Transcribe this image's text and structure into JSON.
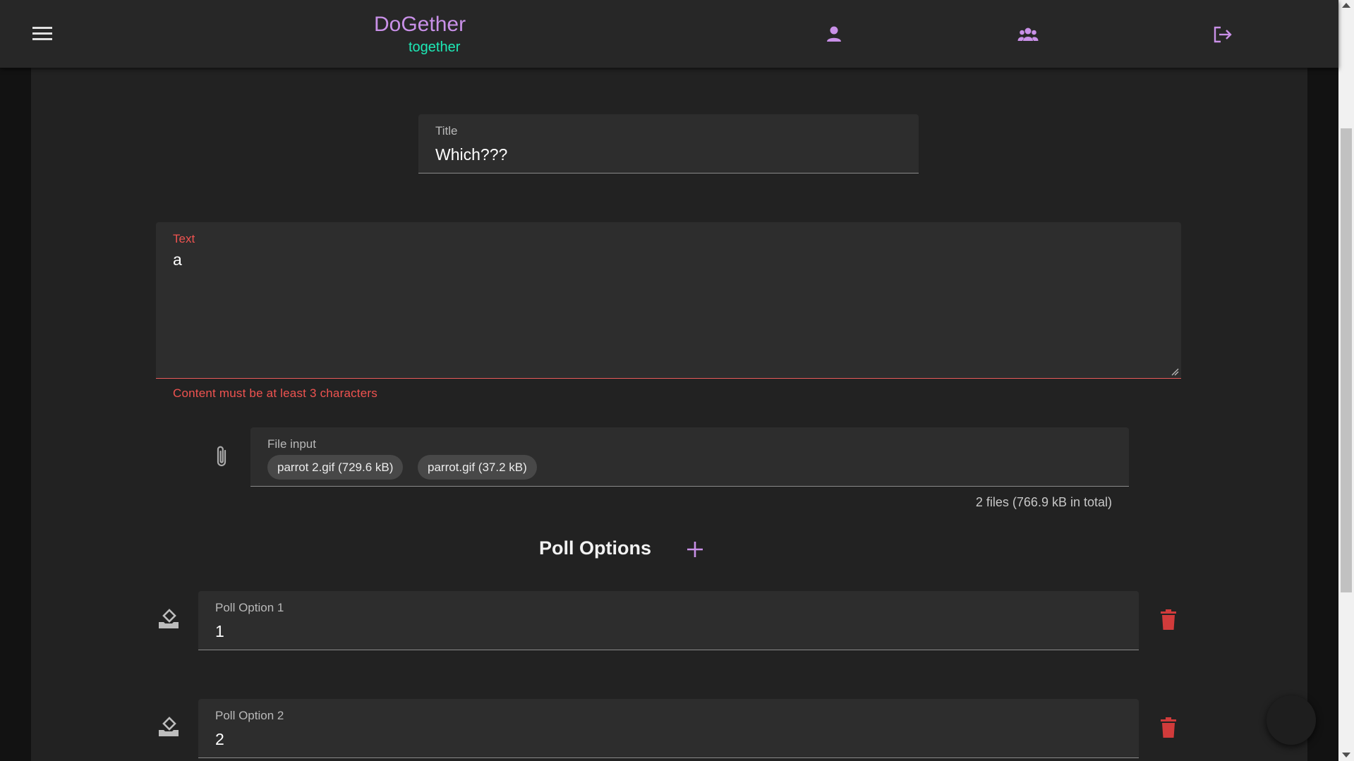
{
  "app": {
    "title": "DoGether",
    "subtitle": "together"
  },
  "navbar": {
    "icons": [
      "menu-icon",
      "account-icon",
      "groups-icon",
      "logout-icon"
    ]
  },
  "form": {
    "title": {
      "label": "Title",
      "value": "Which???"
    },
    "text": {
      "label": "Text",
      "value": "a",
      "error": "Content must be at least 3 characters"
    },
    "file_input": {
      "label": "File input",
      "chips": [
        "parrot 2.gif (729.6 kB)",
        "parrot.gif (37.2 kB)"
      ],
      "summary": "2 files (766.9 kB in total)"
    },
    "poll": {
      "heading": "Poll Options",
      "options": [
        {
          "label": "Poll Option 1",
          "value": "1"
        },
        {
          "label": "Poll Option 2",
          "value": "2"
        }
      ]
    }
  },
  "colors": {
    "brand": "#c990e8",
    "accent": "#1de9b6",
    "error": "#ef5350",
    "delete": "#d13b3b"
  }
}
